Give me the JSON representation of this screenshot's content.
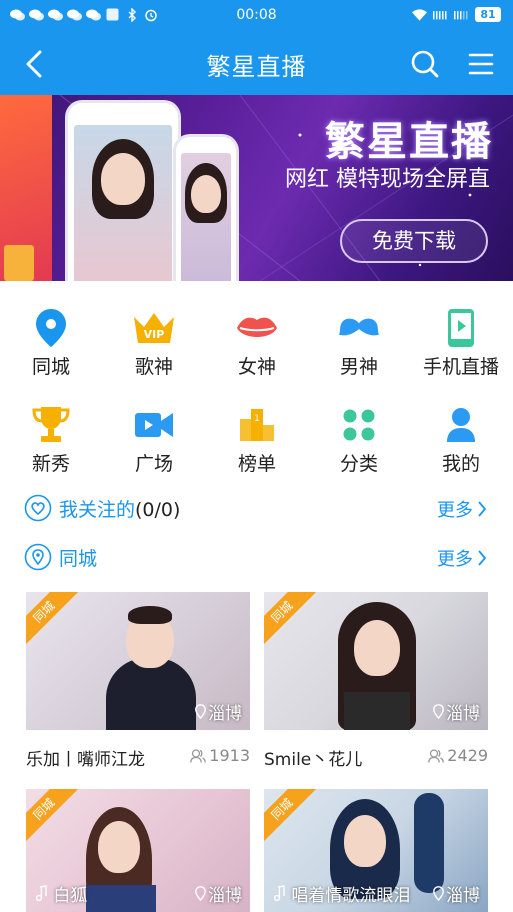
{
  "status_bar": {
    "time": "00:08",
    "battery": "81"
  },
  "app_bar": {
    "title": "繁星直播"
  },
  "banner": {
    "title": "繁星直播",
    "subtitle": "网红 模特现场全屏直",
    "button": "免费下载"
  },
  "categories": [
    {
      "label": "同城",
      "icon": "location-pin-icon",
      "color": "#1B96EE"
    },
    {
      "label": "歌神",
      "icon": "vip-crown-icon",
      "color": "#F5B000"
    },
    {
      "label": "女神",
      "icon": "lips-icon",
      "color": "#F0524E"
    },
    {
      "label": "男神",
      "icon": "mustache-icon",
      "color": "#2A9AF3"
    },
    {
      "label": "手机直播",
      "icon": "phone-play-icon",
      "color": "#3CC79A"
    },
    {
      "label": "新秀",
      "icon": "trophy-icon",
      "color": "#F5B000"
    },
    {
      "label": "广场",
      "icon": "video-camera-icon",
      "color": "#2A9AF3"
    },
    {
      "label": "榜单",
      "icon": "podium-icon",
      "color": "#F5B000"
    },
    {
      "label": "分类",
      "icon": "grid-dots-icon",
      "color": "#3CC79A"
    },
    {
      "label": "我的",
      "icon": "user-icon",
      "color": "#2A9AF3"
    }
  ],
  "following": {
    "title": "我关注的",
    "count": "(0/0)",
    "more": "更多"
  },
  "local": {
    "title": "同城",
    "more": "更多"
  },
  "cards": [
    {
      "tag": "同城",
      "location": "淄博",
      "name": "乐加丨嘴师江龙",
      "views": "1913"
    },
    {
      "tag": "同城",
      "location": "淄博",
      "name": "Smile丶花儿",
      "views": "2429"
    },
    {
      "tag": "同城",
      "location": "淄博",
      "name": "白狐",
      "views": ""
    },
    {
      "tag": "同城",
      "location": "淄博",
      "name": "唱着情歌流眼泪",
      "views": ""
    }
  ],
  "colors": {
    "primary": "#1B96EE",
    "tag": "#F7A21C"
  }
}
